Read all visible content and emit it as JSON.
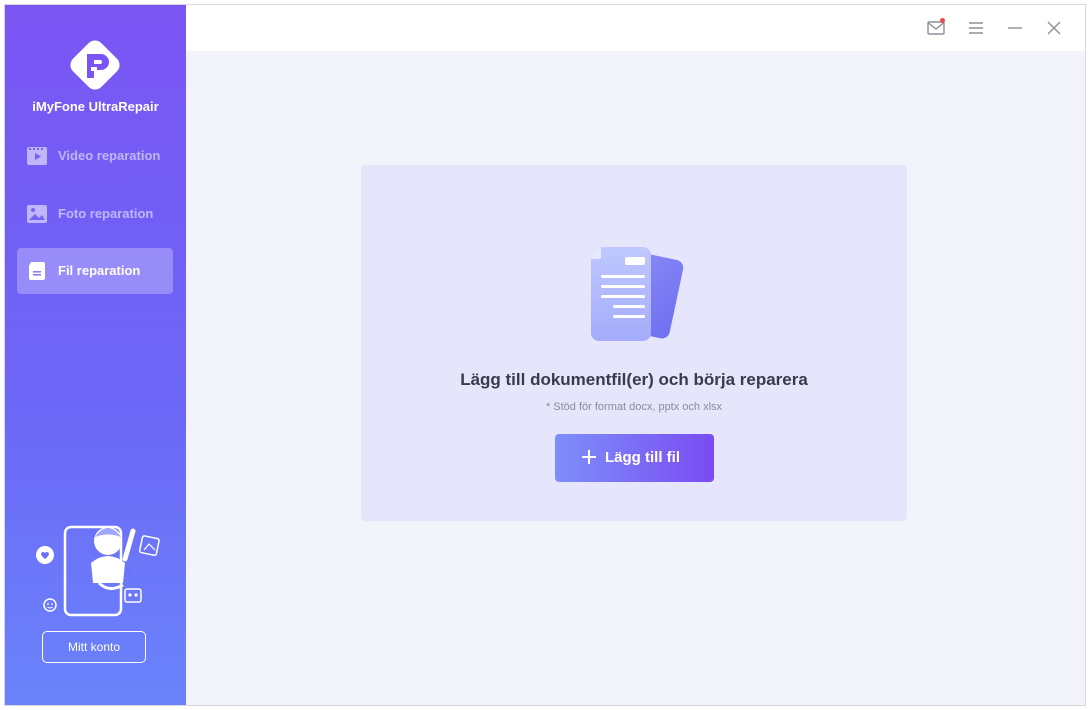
{
  "app": {
    "name": "iMyFone UltraRepair"
  },
  "sidebar": {
    "items": [
      {
        "label": "Video reparation",
        "icon": "video-icon",
        "active": false
      },
      {
        "label": "Foto reparation",
        "icon": "photo-icon",
        "active": false
      },
      {
        "label": "Fil reparation",
        "icon": "file-icon",
        "active": true
      }
    ],
    "account_button": "Mitt konto"
  },
  "titlebar": {
    "icons": [
      "mail-icon",
      "menu-icon",
      "minimize-icon",
      "close-icon"
    ],
    "mail_has_notification": true
  },
  "main": {
    "title": "Lägg till dokumentfil(er) och börja reparera",
    "note": "* Stöd för format docx, pptx och xlsx",
    "add_button": "Lägg till fil"
  },
  "colors": {
    "sidebar_top": "#7a55f3",
    "sidebar_bottom": "#6a83fa",
    "accent": "#7a4cf2",
    "panel_bg": "#e5e6fb",
    "notification": "#f04b4b"
  }
}
